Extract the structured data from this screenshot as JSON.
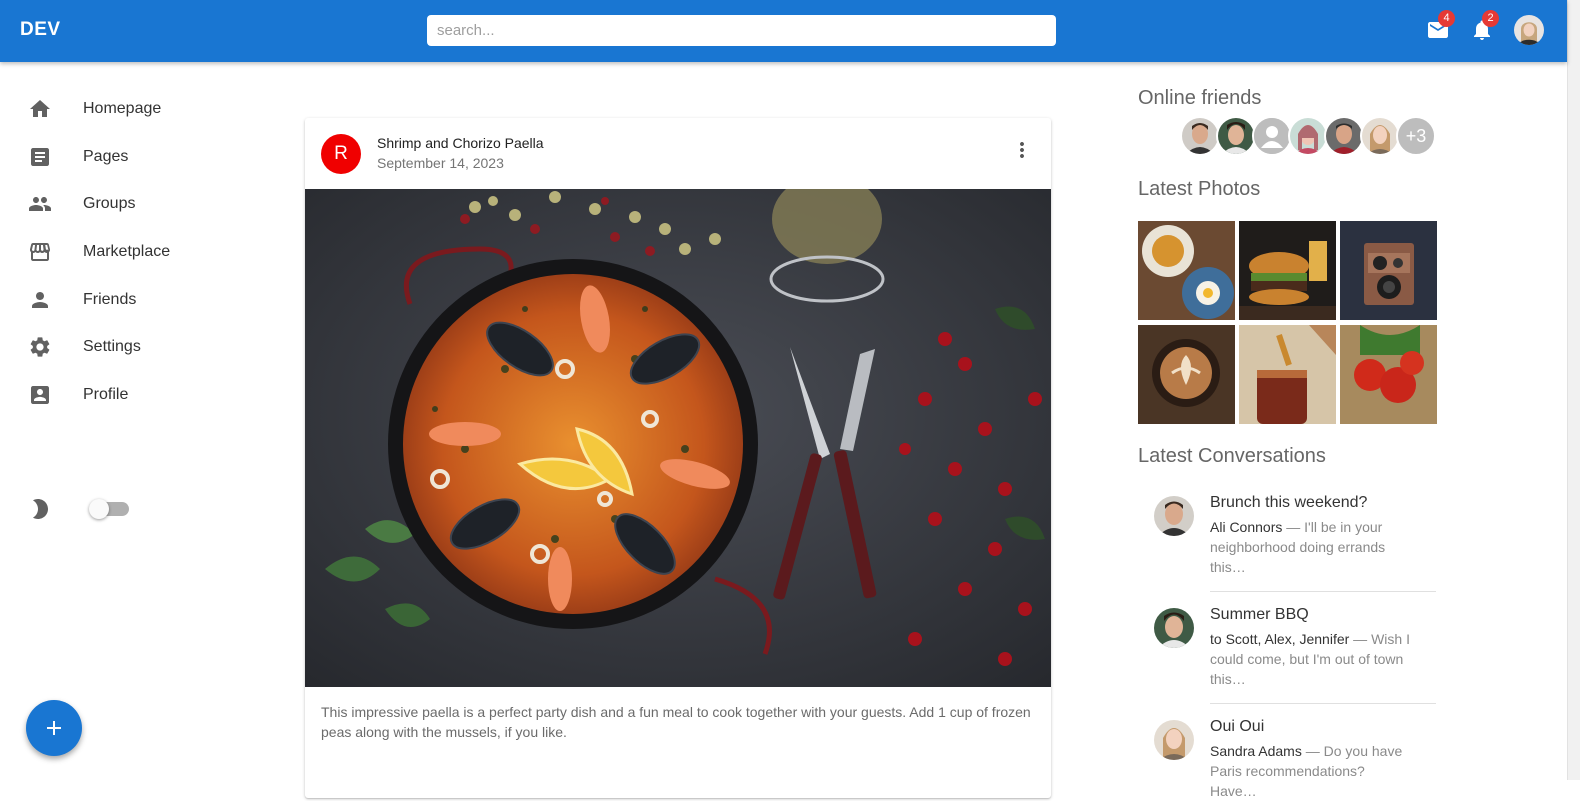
{
  "appbar": {
    "brand": "DEV",
    "search_placeholder": "search...",
    "mail_count": "4",
    "notifications_count": "2"
  },
  "sidebar": {
    "items": [
      {
        "label": "Homepage",
        "icon": "home-icon"
      },
      {
        "label": "Pages",
        "icon": "article-icon"
      },
      {
        "label": "Groups",
        "icon": "people-icon"
      },
      {
        "label": "Marketplace",
        "icon": "storefront-icon"
      },
      {
        "label": "Friends",
        "icon": "person-icon"
      },
      {
        "label": "Settings",
        "icon": "gear-icon"
      },
      {
        "label": "Profile",
        "icon": "account-box-icon"
      }
    ],
    "dark_mode": false
  },
  "post": {
    "avatar_letter": "R",
    "title": "Shrimp and Chorizo Paella",
    "date": "September 14, 2023",
    "text": "This impressive paella is a perfect party dish and a fun meal to cook together with your guests. Add 1 cup of frozen peas along with the mussels, if you like."
  },
  "right": {
    "online_title": "Online friends",
    "online_more": "+3",
    "photos_title": "Latest Photos",
    "conversations_title": "Latest Conversations",
    "conversations": [
      {
        "title": "Brunch this weekend?",
        "from": "Ali Connors",
        "snippet": " — I'll be in your neighborhood doing errands this…"
      },
      {
        "title": "Summer BBQ",
        "from": "to Scott, Alex, Jennifer",
        "snippet": " — Wish I could come, but I'm out of town this…"
      },
      {
        "title": "Oui Oui",
        "from": "Sandra Adams",
        "snippet": " — Do you have Paris recommendations? Have…"
      }
    ]
  },
  "colors": {
    "primary": "#1976d2",
    "badge": "#e53935",
    "post_avatar": "#f00000"
  }
}
